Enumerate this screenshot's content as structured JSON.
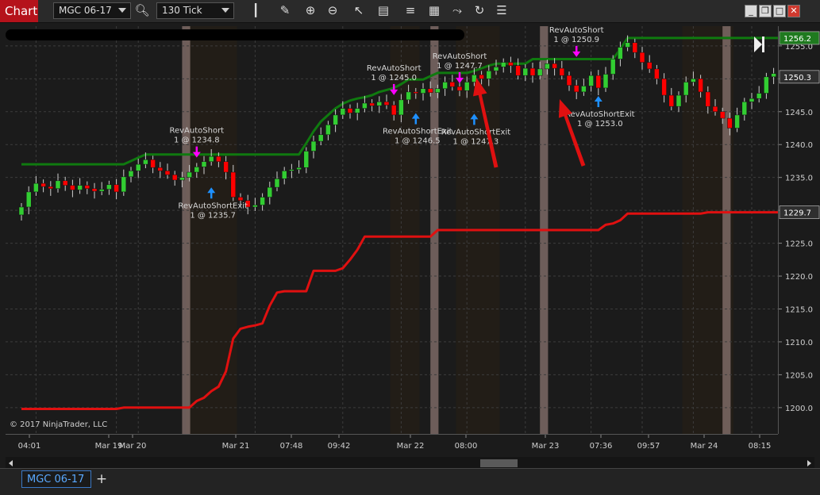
{
  "toolbar": {
    "chart_tab": "Chart",
    "instrument": "MGC 06-17",
    "interval": "130 Tick",
    "icons": [
      "search-icon",
      "bars-type-icon",
      "draw-icon",
      "zoom-in-icon",
      "zoom-out-icon",
      "pointer-icon",
      "data-box-icon",
      "indicators-icon",
      "strategies-icon",
      "templates-icon",
      "reload-icon",
      "properties-icon"
    ],
    "window_icons": [
      "minimize-icon",
      "restore-icon",
      "maximize-icon",
      "close-icon"
    ]
  },
  "bottom": {
    "instrument_tab": "MGC 06-17",
    "add_tab": "+"
  },
  "colors": {
    "background": "#1b1b1b",
    "upper_band": "#0f7a0f",
    "lower_band": "#e01010",
    "up_candle": "#32cd32",
    "down_candle": "#ff0000",
    "entry_arrow": "#ff00ff",
    "exit_arrow": "#1e90ff",
    "session_shade": "#8a7470",
    "annotation_arrow": "#e01010"
  },
  "chart_data": {
    "type": "candlestick",
    "copyright": "© 2017 NinjaTrader, LLC",
    "ylim": [
      1196,
      1258
    ],
    "yticks": [
      1200.0,
      1205.0,
      1210.0,
      1215.0,
      1220.0,
      1225.0,
      1230.0,
      1235.0,
      1240.0,
      1245.0,
      1250.0,
      1255.0
    ],
    "xticks": [
      "04:01",
      "Mar 19",
      "Mar 20",
      "Mar 21",
      "07:48",
      "09:42",
      "Mar 22",
      "08:00",
      "Mar 23",
      "07:36",
      "09:57",
      "Mar 24",
      "08:15"
    ],
    "price_markers": [
      {
        "value": 1256.2,
        "color": "#1f7a1f",
        "label": "1256.2"
      },
      {
        "value": 1250.3,
        "color": "#2f2f2f",
        "label": "1250.3"
      },
      {
        "value": 1229.7,
        "color": "#2f2f2f",
        "label": "1229.7"
      }
    ],
    "closes": [
      1230.5,
      1232.8,
      1234.1,
      1233.6,
      1233.3,
      1234.5,
      1233.8,
      1233.1,
      1233.8,
      1233.3,
      1232.9,
      1233.2,
      1233.9,
      1232.8,
      1235.1,
      1236.0,
      1237.0,
      1237.7,
      1236.5,
      1236.0,
      1235.4,
      1234.6,
      1235.0,
      1235.8,
      1236.6,
      1237.4,
      1238.2,
      1237.4,
      1235.8,
      1232.0,
      1231.5,
      1230.5,
      1230.8,
      1232.0,
      1233.5,
      1234.8,
      1236.0,
      1236.2,
      1236.5,
      1239.0,
      1240.5,
      1241.5,
      1243.0,
      1244.5,
      1245.5,
      1244.8,
      1245.5,
      1246.3,
      1245.9,
      1246.5,
      1246.0,
      1244.5,
      1246.8,
      1248.0,
      1247.8,
      1248.5,
      1247.9,
      1248.5,
      1249.5,
      1248.8,
      1248.2,
      1249.5,
      1250.6,
      1250.0,
      1251.2,
      1251.8,
      1252.5,
      1252.0,
      1250.5,
      1251.6,
      1250.5,
      1251.5,
      1252.3,
      1251.6,
      1250.5,
      1249.0,
      1248.0,
      1248.9,
      1250.5,
      1248.6,
      1250.7,
      1253.0,
      1254.8,
      1255.5,
      1254.0,
      1252.5,
      1251.5,
      1250.0,
      1247.5,
      1245.8,
      1247.5,
      1249.5,
      1250.0,
      1248.0,
      1245.8,
      1245.0,
      1244.0,
      1242.5,
      1244.5,
      1246.5,
      1247.0,
      1247.8,
      1250.3,
      1250.8,
      1250.3
    ],
    "series": [
      {
        "name": "upper",
        "values": [
          1237.0,
          1237.0,
          1237.0,
          1237.0,
          1237.0,
          1237.0,
          1237.0,
          1237.0,
          1237.0,
          1237.0,
          1237.0,
          1237.0,
          1237.0,
          1237.0,
          1237.0,
          1237.5,
          1238.0,
          1238.5,
          1238.5,
          1238.5,
          1238.5,
          1238.5,
          1238.5,
          1238.5,
          1238.5,
          1238.5,
          1238.5,
          1238.5,
          1238.5,
          1238.5,
          1238.5,
          1238.5,
          1238.5,
          1238.5,
          1238.5,
          1238.5,
          1238.5,
          1238.5,
          1238.5,
          1240.2,
          1242.0,
          1243.5,
          1244.5,
          1245.5,
          1246.2,
          1246.7,
          1247.0,
          1247.2,
          1247.5,
          1248.0,
          1248.3,
          1248.6,
          1249.2,
          1249.9,
          1249.9,
          1249.9,
          1250.4,
          1250.9,
          1250.9,
          1250.9,
          1250.9,
          1250.9,
          1251.2,
          1251.6,
          1252.0,
          1252.3,
          1252.3,
          1252.3,
          1252.3,
          1252.3,
          1253.0,
          1253.0,
          1253.0,
          1253.0,
          1253.0,
          1253.0,
          1253.0,
          1253.0,
          1253.0,
          1253.0,
          1253.0,
          1253.0,
          1254.5,
          1256.2,
          1256.2,
          1256.2,
          1256.2,
          1256.2,
          1256.2,
          1256.2,
          1256.2,
          1256.2,
          1256.2,
          1256.2,
          1256.2,
          1256.2,
          1256.2,
          1256.2,
          1256.2,
          1256.2,
          1256.2,
          1256.2,
          1256.2,
          1256.2,
          1256.2
        ]
      },
      {
        "name": "lower",
        "values": [
          1199.8,
          1199.8,
          1199.8,
          1199.8,
          1199.8,
          1199.8,
          1199.8,
          1199.8,
          1199.8,
          1199.8,
          1199.8,
          1199.8,
          1199.8,
          1199.8,
          1200.0,
          1200.0,
          1200.0,
          1200.0,
          1200.0,
          1200.0,
          1200.0,
          1200.0,
          1200.0,
          1200.0,
          1201.0,
          1201.5,
          1202.5,
          1203.2,
          1205.5,
          1210.5,
          1212.0,
          1212.3,
          1212.5,
          1212.8,
          1215.5,
          1217.5,
          1217.7,
          1217.7,
          1217.7,
          1217.7,
          1220.8,
          1220.8,
          1220.8,
          1220.8,
          1221.2,
          1222.5,
          1224.0,
          1226.0,
          1226.0,
          1226.0,
          1226.0,
          1226.0,
          1226.0,
          1226.0,
          1226.0,
          1226.0,
          1226.0,
          1227.0,
          1227.0,
          1227.0,
          1227.0,
          1227.0,
          1227.0,
          1227.0,
          1227.0,
          1227.0,
          1227.0,
          1227.0,
          1227.0,
          1227.0,
          1227.0,
          1227.0,
          1227.0,
          1227.0,
          1227.0,
          1227.0,
          1227.0,
          1227.0,
          1227.0,
          1227.0,
          1227.8,
          1228.0,
          1228.5,
          1229.5,
          1229.5,
          1229.5,
          1229.5,
          1229.5,
          1229.5,
          1229.5,
          1229.5,
          1229.5,
          1229.5,
          1229.5,
          1229.7,
          1229.7,
          1229.7,
          1229.7,
          1229.7,
          1229.7,
          1229.7,
          1229.7,
          1229.7,
          1229.7,
          1229.7
        ]
      }
    ],
    "sessions": [
      [
        22,
        23
      ],
      [
        56,
        57
      ],
      [
        71,
        72
      ],
      [
        96,
        97
      ]
    ],
    "day_shade": [
      [
        23,
        30
      ],
      [
        51,
        55
      ],
      [
        60,
        66
      ],
      [
        91,
        98
      ]
    ],
    "signals": [
      {
        "bar": 24,
        "price": 1238.5,
        "type": "entry",
        "label": [
          "RevAutoShort",
          "1 @ 1234.8"
        ]
      },
      {
        "bar": 26,
        "price": 1233.0,
        "type": "exit",
        "label": [
          "RevAutoShortExit",
          "1 @ 1235.7"
        ]
      },
      {
        "bar": 51,
        "price": 1248.0,
        "type": "entry",
        "label": [
          "RevAutoShort",
          "1 @ 1245.0"
        ]
      },
      {
        "bar": 54,
        "price": 1244.3,
        "type": "exit",
        "label": [
          "RevAutoShortExit",
          "1 @ 1246.5"
        ]
      },
      {
        "bar": 60,
        "price": 1249.8,
        "type": "entry",
        "label": [
          "RevAutoShort",
          "1 @ 1247.7"
        ]
      },
      {
        "bar": 62,
        "price": 1244.2,
        "type": "exit",
        "label": [
          "RevAutoShortExit",
          "1 @ 1247.3"
        ]
      },
      {
        "bar": 76,
        "price": 1253.8,
        "type": "entry",
        "label": [
          "RevAutoShort",
          "1 @ 1250.9"
        ]
      },
      {
        "bar": 79,
        "price": 1246.9,
        "type": "exit",
        "label": [
          "RevAutoShortExit",
          "1 @ 1253.0"
        ]
      }
    ]
  }
}
